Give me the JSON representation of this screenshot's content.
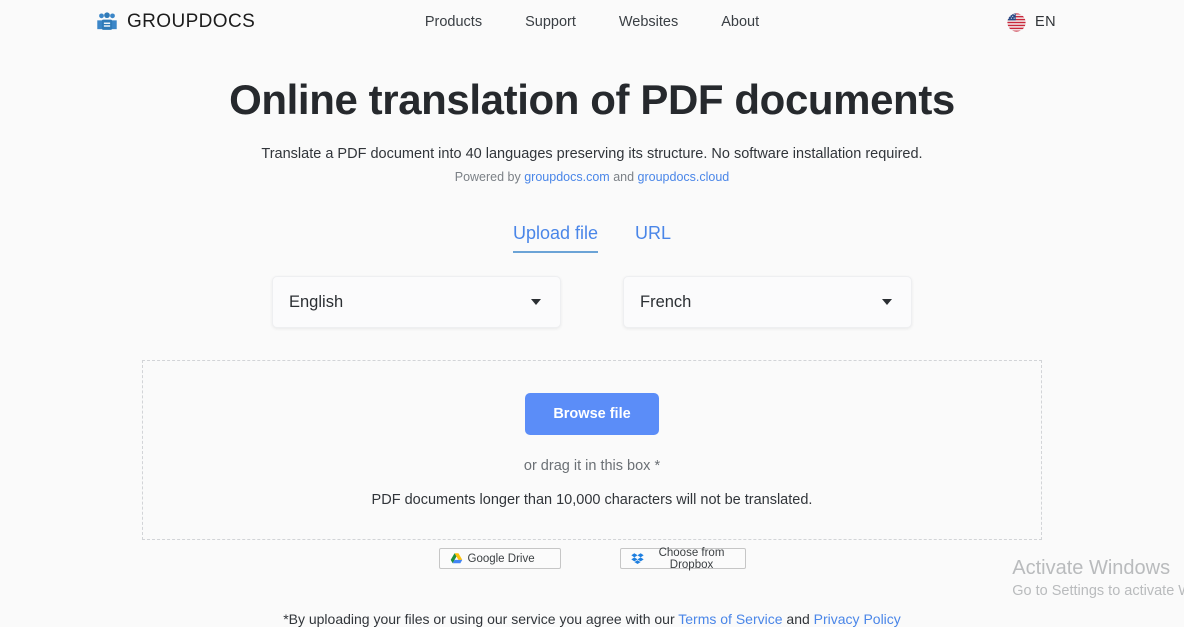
{
  "header": {
    "brand": {
      "name": "GROUPDOCS",
      "icon": "group-people-icon"
    },
    "nav": [
      {
        "label": "Products"
      },
      {
        "label": "Support"
      },
      {
        "label": "Websites"
      },
      {
        "label": "About"
      }
    ],
    "language": {
      "code": "EN",
      "flag": "us-flag-icon"
    }
  },
  "hero": {
    "title": "Online translation of PDF documents",
    "subtitle": "Translate a PDF document into 40 languages preserving its structure. No software installation required.",
    "powered_prefix": "Powered by",
    "powered_link1": "groupdocs.com",
    "powered_and": "and",
    "powered_link2": "groupdocs.cloud"
  },
  "tabs": [
    {
      "label": "Upload file",
      "active": true
    },
    {
      "label": "URL",
      "active": false
    }
  ],
  "selects": {
    "source_language": "English",
    "target_language": "French"
  },
  "dropzone": {
    "browse_label": "Browse file",
    "drag_text": "or drag it in this box *",
    "limit_text": "PDF documents longer than 10,000 characters will not be translated."
  },
  "cloud_buttons": [
    {
      "label": "Google Drive",
      "icon": "google-drive-icon"
    },
    {
      "label": "Choose from Dropbox",
      "icon": "dropbox-icon"
    }
  ],
  "legal": {
    "text_before": "*By uploading your files or using our service you agree with our",
    "terms_link": "Terms of Service",
    "and_text": "and",
    "privacy_link": "Privacy Policy"
  },
  "watermark": {
    "title": "Activate Windows",
    "subtitle": "Go to Settings to activate W"
  },
  "colors": {
    "accent_blue": "#4a86e8",
    "button_blue": "#5b8df8",
    "page_background": "#fafafa",
    "watermark_gray": "#b9bbbd"
  }
}
